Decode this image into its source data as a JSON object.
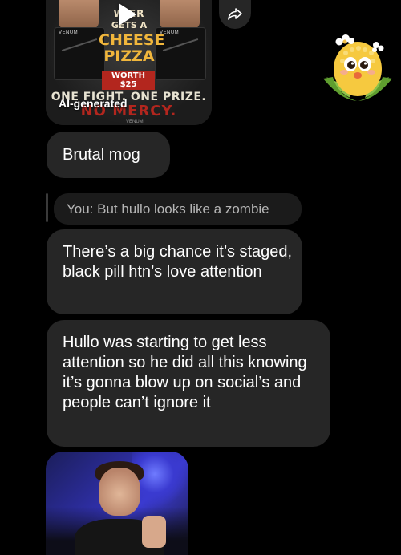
{
  "media_card": {
    "poster": {
      "line1": "W   ER",
      "line2": "GETS A",
      "cheese": "CHEESE",
      "pizza": "PIZZA",
      "worth": "WORTH $25",
      "slogan": "ONE FIGHT. ONE PRIZE.",
      "mercy": "NO MERCY.",
      "brand_left": "VENUM",
      "brand_right": "VENUM",
      "footer": "VENUM"
    },
    "ai_label": "AI-generated",
    "play_icon": "play-icon",
    "share_icon": "share-arrow-icon"
  },
  "sticker": {
    "icon": "corn-mascot-sticker"
  },
  "messages": [
    {
      "id": "m1",
      "text": "Brutal mog"
    },
    {
      "id": "m2",
      "text": "There’s a big chance it’s staged, black pill htn’s love attention"
    },
    {
      "id": "m3",
      "text": "Hullo was starting to get less attention so he did all this knowing it’s gonna blow up on social’s and people can’t ignore it"
    }
  ],
  "reply_quote": {
    "text": "You: But hullo looks like a zombie"
  },
  "photo": {
    "icon": "photo-attachment"
  },
  "colors": {
    "background": "#000000",
    "bubble": "#262626",
    "quote_bg": "#1b1b1b",
    "quote_text": "#b5b5b5",
    "text": "#ffffff"
  }
}
